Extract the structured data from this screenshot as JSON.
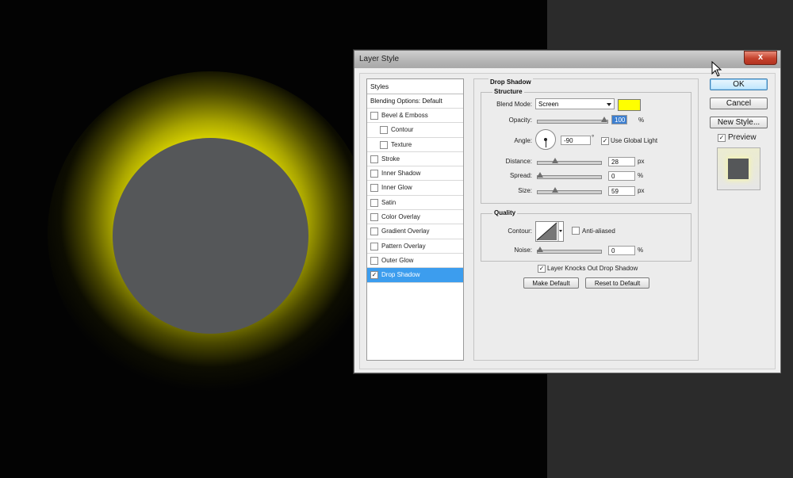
{
  "dialog": {
    "title": "Layer Style",
    "close_label": "x"
  },
  "styles": {
    "header": "Styles",
    "blending": "Blending Options: Default",
    "items": [
      {
        "label": "Bevel & Emboss",
        "checked": false
      },
      {
        "label": "Contour",
        "checked": false
      },
      {
        "label": "Texture",
        "checked": false
      },
      {
        "label": "Stroke",
        "checked": false
      },
      {
        "label": "Inner Shadow",
        "checked": false
      },
      {
        "label": "Inner Glow",
        "checked": false
      },
      {
        "label": "Satin",
        "checked": false
      },
      {
        "label": "Color Overlay",
        "checked": false
      },
      {
        "label": "Gradient Overlay",
        "checked": false
      },
      {
        "label": "Pattern Overlay",
        "checked": false
      },
      {
        "label": "Outer Glow",
        "checked": false
      },
      {
        "label": "Drop Shadow",
        "checked": true
      }
    ]
  },
  "drop_shadow": {
    "title": "Drop Shadow",
    "structure_title": "Structure",
    "blend_mode_label": "Blend Mode:",
    "blend_mode_value": "Screen",
    "shadow_color": "#ffff00",
    "opacity_label": "Opacity:",
    "opacity_value": "100",
    "opacity_unit": "%",
    "angle_label": "Angle:",
    "angle_value": "-90",
    "angle_unit": "°",
    "use_global_light_label": "Use Global Light",
    "distance_label": "Distance:",
    "distance_value": "28",
    "distance_unit": "px",
    "spread_label": "Spread:",
    "spread_value": "0",
    "spread_unit": "%",
    "size_label": "Size:",
    "size_value": "59",
    "size_unit": "px",
    "quality_title": "Quality",
    "contour_label": "Contour:",
    "anti_aliased_label": "Anti-aliased",
    "noise_label": "Noise:",
    "noise_value": "0",
    "noise_unit": "%",
    "knocks_out_label": "Layer Knocks Out Drop Shadow",
    "make_default_label": "Make Default",
    "reset_default_label": "Reset to Default"
  },
  "buttons": {
    "ok": "OK",
    "cancel": "Cancel",
    "new_style": "New Style...",
    "preview_label": "Preview"
  },
  "colors": {
    "glow": "#f4f000",
    "planet": "#555759",
    "selection": "#3c9dee"
  }
}
